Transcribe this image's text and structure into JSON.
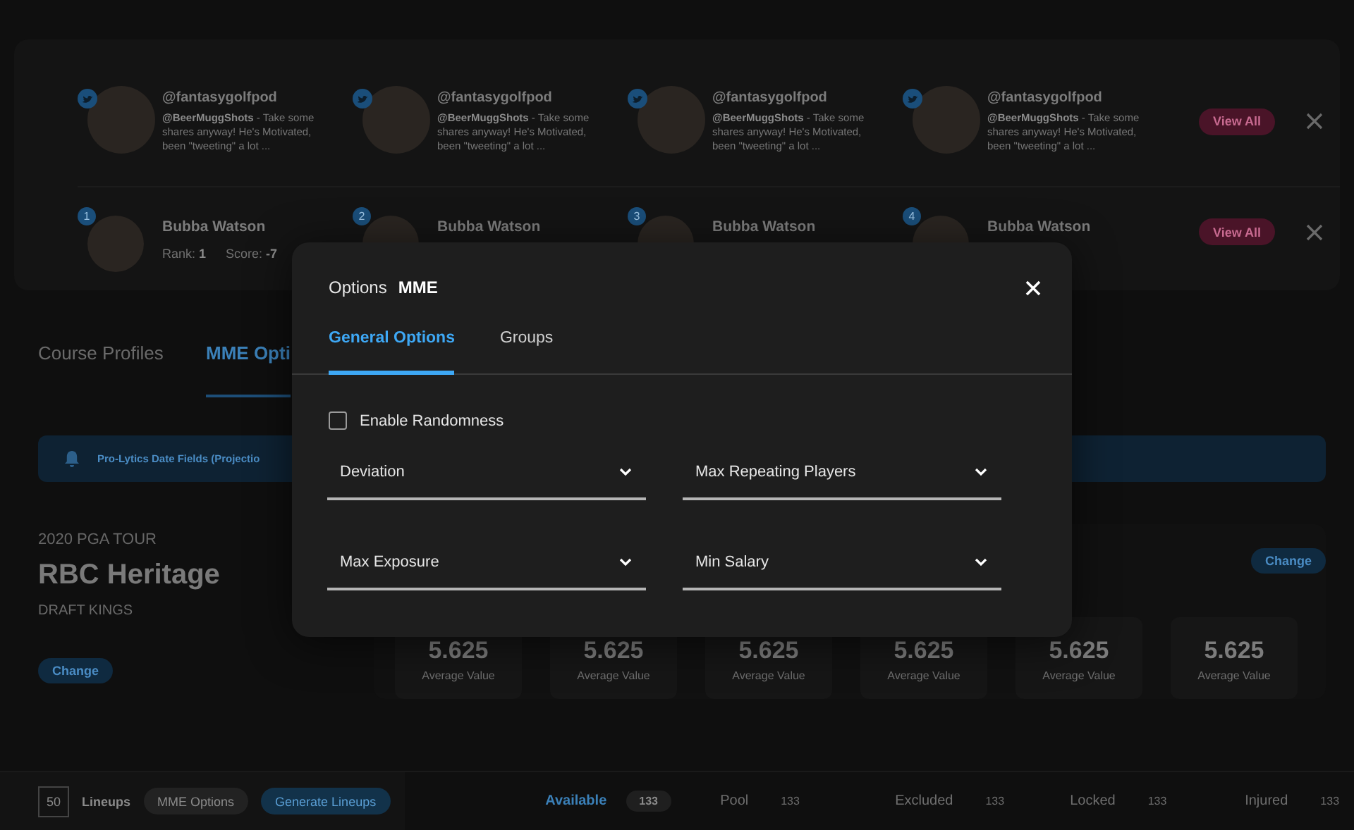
{
  "tweets": [
    {
      "handle": "@fantasygolfpod",
      "text": "**@BeerMuggShots** - Take some shares anyway! He's Motivated, been \"tweeting\" a lot ..."
    },
    {
      "handle": "@fantasygolfpod",
      "text": "**@BeerMuggShots** - Take some shares anyway! He's Motivated, been \"tweeting\" a lot ..."
    },
    {
      "handle": "@fantasygolfpod",
      "text": "**@BeerMuggShots** - Take some shares anyway! He's Motivated, been \"tweeting\" a lot ..."
    },
    {
      "handle": "@fantasygolfpod",
      "text": "**@BeerMuggShots** - Take some shares anyway! He's Motivated, been \"tweeting\" a lot ..."
    }
  ],
  "tweets_view_all": "View All",
  "players": [
    {
      "badge": "1",
      "name": "Bubba Watson",
      "rank_label": "Rank:",
      "rank": "1",
      "score_label": "Score:",
      "score": "-7"
    },
    {
      "badge": "2",
      "name": "Bubba Watson"
    },
    {
      "badge": "3",
      "name": "Bubba Watson"
    },
    {
      "badge": "4",
      "name": "Bubba Watson"
    }
  ],
  "players_view_all": "View All",
  "page_tabs": [
    {
      "label": "Course Profiles",
      "selected": false
    },
    {
      "label": "MME Opti",
      "selected": true
    }
  ],
  "alert": {
    "text": "Pro-Lytics Date Fields (Projectio"
  },
  "event": {
    "season": "2020 PGA TOUR",
    "title": "RBC Heritage",
    "site": "DRAFT KINGS",
    "change": "Change"
  },
  "stats_change": "Change",
  "stats": [
    {
      "value": "5.625",
      "label": "Average Value"
    },
    {
      "value": "5.625",
      "label": "Average Value"
    },
    {
      "value": "5.625",
      "label": "Average Value"
    },
    {
      "value": "5.625",
      "label": "Average Value"
    },
    {
      "value": "5.625",
      "label": "Average Value"
    },
    {
      "value": "5.625",
      "label": "Average Value"
    }
  ],
  "bottom_bar": {
    "lineups_count": "50",
    "lineups_label": "Lineups",
    "buttons": [
      {
        "label": "MME Options",
        "kind": "secondary"
      },
      {
        "label": "Generate Lineups",
        "kind": "primary"
      }
    ],
    "pools": [
      {
        "label": "Available",
        "count": "133",
        "selected": true
      },
      {
        "label": "Pool",
        "count": "133",
        "selected": false
      },
      {
        "label": "Excluded",
        "count": "133",
        "selected": false
      },
      {
        "label": "Locked",
        "count": "133",
        "selected": false
      },
      {
        "label": "Injured",
        "count": "133",
        "selected": false
      }
    ]
  },
  "modal": {
    "title": "Options",
    "subtitle": "MME",
    "tabs": [
      {
        "label": "General Options",
        "selected": true
      },
      {
        "label": "Groups",
        "selected": false
      }
    ],
    "randomness": {
      "label": "Enable Randomness",
      "checked": false
    },
    "dropdowns": [
      {
        "label": "Deviation"
      },
      {
        "label": "Max Repeating Players"
      },
      {
        "label": "Max Exposure"
      },
      {
        "label": "Min Salary"
      }
    ]
  }
}
